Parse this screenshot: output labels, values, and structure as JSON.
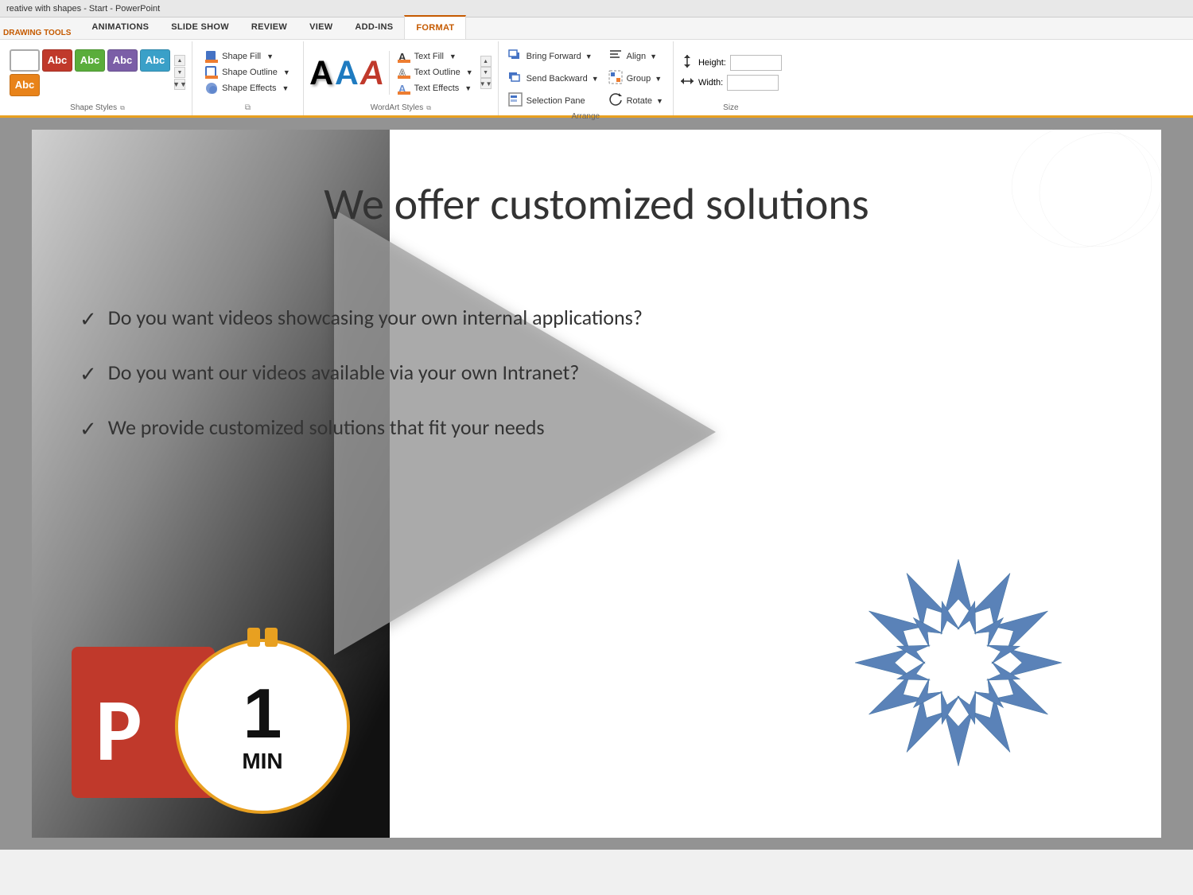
{
  "titlebar": {
    "title": "reative with shapes - Start - PowerPoint"
  },
  "ribbon": {
    "tabs": [
      {
        "label": "ANIMATIONS",
        "active": false
      },
      {
        "label": "SLIDE SHOW",
        "active": false
      },
      {
        "label": "REVIEW",
        "active": false
      },
      {
        "label": "VIEW",
        "active": false
      },
      {
        "label": "ADD-INS",
        "active": false
      },
      {
        "label": "FORMAT",
        "active": true
      }
    ],
    "drawing_tools_label": "DRAWING TOOLS",
    "groups": {
      "shape_styles": {
        "label": "Shape Styles",
        "swatches": [
          {
            "color": "#d33b2c",
            "text": "Abc"
          },
          {
            "color": "#6aad3b",
            "text": "Abc"
          },
          {
            "color": "#7b5ea7",
            "text": "Abc"
          },
          {
            "color": "#3aa0c8",
            "text": "Abc"
          },
          {
            "color": "#e8831a",
            "text": "Abc"
          }
        ]
      },
      "shape_cmds": {
        "fill_label": "Shape Fill",
        "outline_label": "Shape Outline",
        "effects_label": "Shape Effects"
      },
      "wordart": {
        "label": "WordArt Styles",
        "text_fill_label": "Text Fill",
        "text_outline_label": "Text Outline",
        "text_effects_label": "Text Effects"
      },
      "arrange": {
        "label": "Arrange",
        "bring_forward_label": "Bring Forward",
        "send_backward_label": "Send Backward",
        "selection_pane_label": "Selection Pane",
        "align_label": "Align",
        "group_label": "Group",
        "rotate_label": "Rotate"
      },
      "size": {
        "label": "Size",
        "height_label": "Height:",
        "width_label": "Width:",
        "height_value": "",
        "width_value": ""
      }
    }
  },
  "slide": {
    "title": "We offer customized solutions",
    "bullets": [
      "Do you want videos showcasing your own internal applications?",
      "Do you want our videos available via your own Intranet?",
      "We provide customized solutions that fit your needs"
    ],
    "timer_number": "1",
    "timer_unit": "MIN",
    "ppt_logo_letter": "P"
  }
}
